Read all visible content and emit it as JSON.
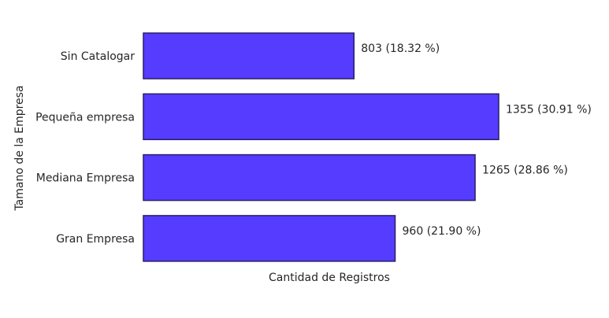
{
  "chart_data": {
    "type": "bar",
    "orientation": "horizontal",
    "categories": [
      "Sin Catalogar",
      "Pequeña empresa",
      "Mediana Empresa",
      "Gran Empresa"
    ],
    "values": [
      803,
      1355,
      1265,
      960
    ],
    "data_labels": [
      "803 (18.32 %)",
      "1355 (30.91 %)",
      "1265 (28.86 %)",
      "960 (21.90 %)"
    ],
    "title": "",
    "xlabel": "Cantidad de Registros",
    "ylabel": "Tamano de la Empresa",
    "xlim": [
      0,
      1355
    ],
    "grid": false,
    "bar_color": "#553cff",
    "bar_edge_color": "#2a1f66"
  }
}
